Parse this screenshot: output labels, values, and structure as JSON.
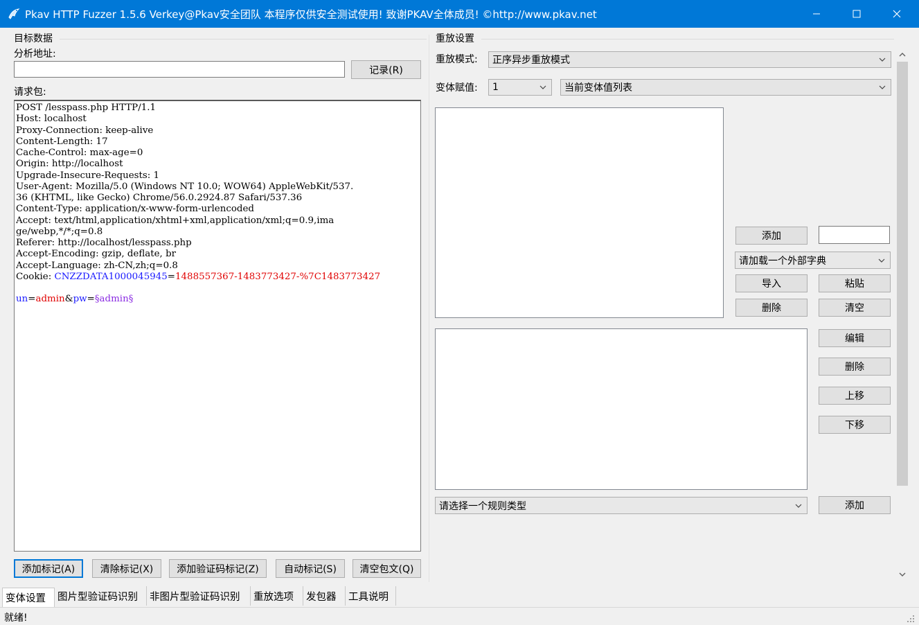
{
  "window": {
    "title": "Pkav HTTP Fuzzer 1.5.6  Verkey@Pkav安全团队  本程序仅供安全测试使用!  致谢PKAV全体成员! ©http://www.pkav.net"
  },
  "target": {
    "group_label": "目标数据",
    "address_label": "分析地址:",
    "address_value": "",
    "record_button": "记录(R)",
    "request_label": "请求包:",
    "request_lines": [
      "POST /lesspass.php HTTP/1.1",
      "Host: localhost",
      "Proxy-Connection: keep-alive",
      "Content-Length: 17",
      "Cache-Control: max-age=0",
      "Origin: http://localhost",
      "Upgrade-Insecure-Requests: 1",
      "User-Agent: Mozilla/5.0 (Windows NT 10.0; WOW64) AppleWebKit/537.",
      "36 (KHTML, like Gecko) Chrome/56.0.2924.87 Safari/537.36",
      "Content-Type: application/x-www-form-urlencoded",
      "Accept: text/html,application/xhtml+xml,application/xml;q=0.9,ima",
      "ge/webp,*/*;q=0.8",
      "Referer: http://localhost/lesspass.php",
      "Accept-Encoding: gzip, deflate, br",
      "Accept-Language: zh-CN,zh;q=0.8"
    ],
    "cookie": {
      "prefix": "Cookie: ",
      "name": "CNZZDATA1000045945",
      "eq": "=",
      "value": "1488557367-1483773427-%7C1483773427"
    },
    "body": {
      "k1": "un",
      "eq1": "=",
      "v1": "admin",
      "amp": "&",
      "k2": "pw",
      "eq2": "=",
      "marked": "§admin§"
    },
    "buttons": {
      "add_mark": "添加标记(A)",
      "clear_mark": "清除标记(X)",
      "add_captcha_mark": "添加验证码标记(Z)",
      "auto_mark": "自动标记(S)",
      "clear_packet": "清空包文(Q)"
    }
  },
  "replay": {
    "group_label": "重放设置",
    "mode_label": "重放模式:",
    "mode_value": "正序异步重放模式",
    "var_label": "变体赋值:",
    "var_index": "1",
    "var_list": "当前变体值列表",
    "add_button": "添加",
    "add_input": "",
    "dict_select": "请加载一个外部字典",
    "import_button": "导入",
    "paste_button": "粘贴",
    "delete_button": "删除",
    "clear_button": "清空",
    "edit_button": "编辑",
    "rule_delete_button": "删除",
    "move_up_button": "上移",
    "move_down_button": "下移",
    "rule_select": "请选择一个规则类型",
    "rule_add_button": "添加"
  },
  "tabs": [
    {
      "label": "变体设置",
      "active": true
    },
    {
      "label": "图片型验证码识别",
      "active": false
    },
    {
      "label": "非图片型验证码识别",
      "active": false
    },
    {
      "label": "重放选项",
      "active": false
    },
    {
      "label": "发包器",
      "active": false
    },
    {
      "label": "工具说明",
      "active": false
    }
  ],
  "status": {
    "text": "就绪!"
  },
  "icons": {
    "app": "bird-icon",
    "minimize": "minimize-icon",
    "maximize": "maximize-icon",
    "close": "close-icon",
    "dropdown": "chevron-down-icon",
    "scroll_up": "chevron-up-icon",
    "scroll_down": "chevron-down-icon",
    "grip": "resize-grip-icon"
  },
  "colors": {
    "titlebar": "#0078d7",
    "focus": "#0078d7",
    "cookie_name": "#1a1aff",
    "cookie_value": "#e00000",
    "marked": "#8a2be2"
  }
}
